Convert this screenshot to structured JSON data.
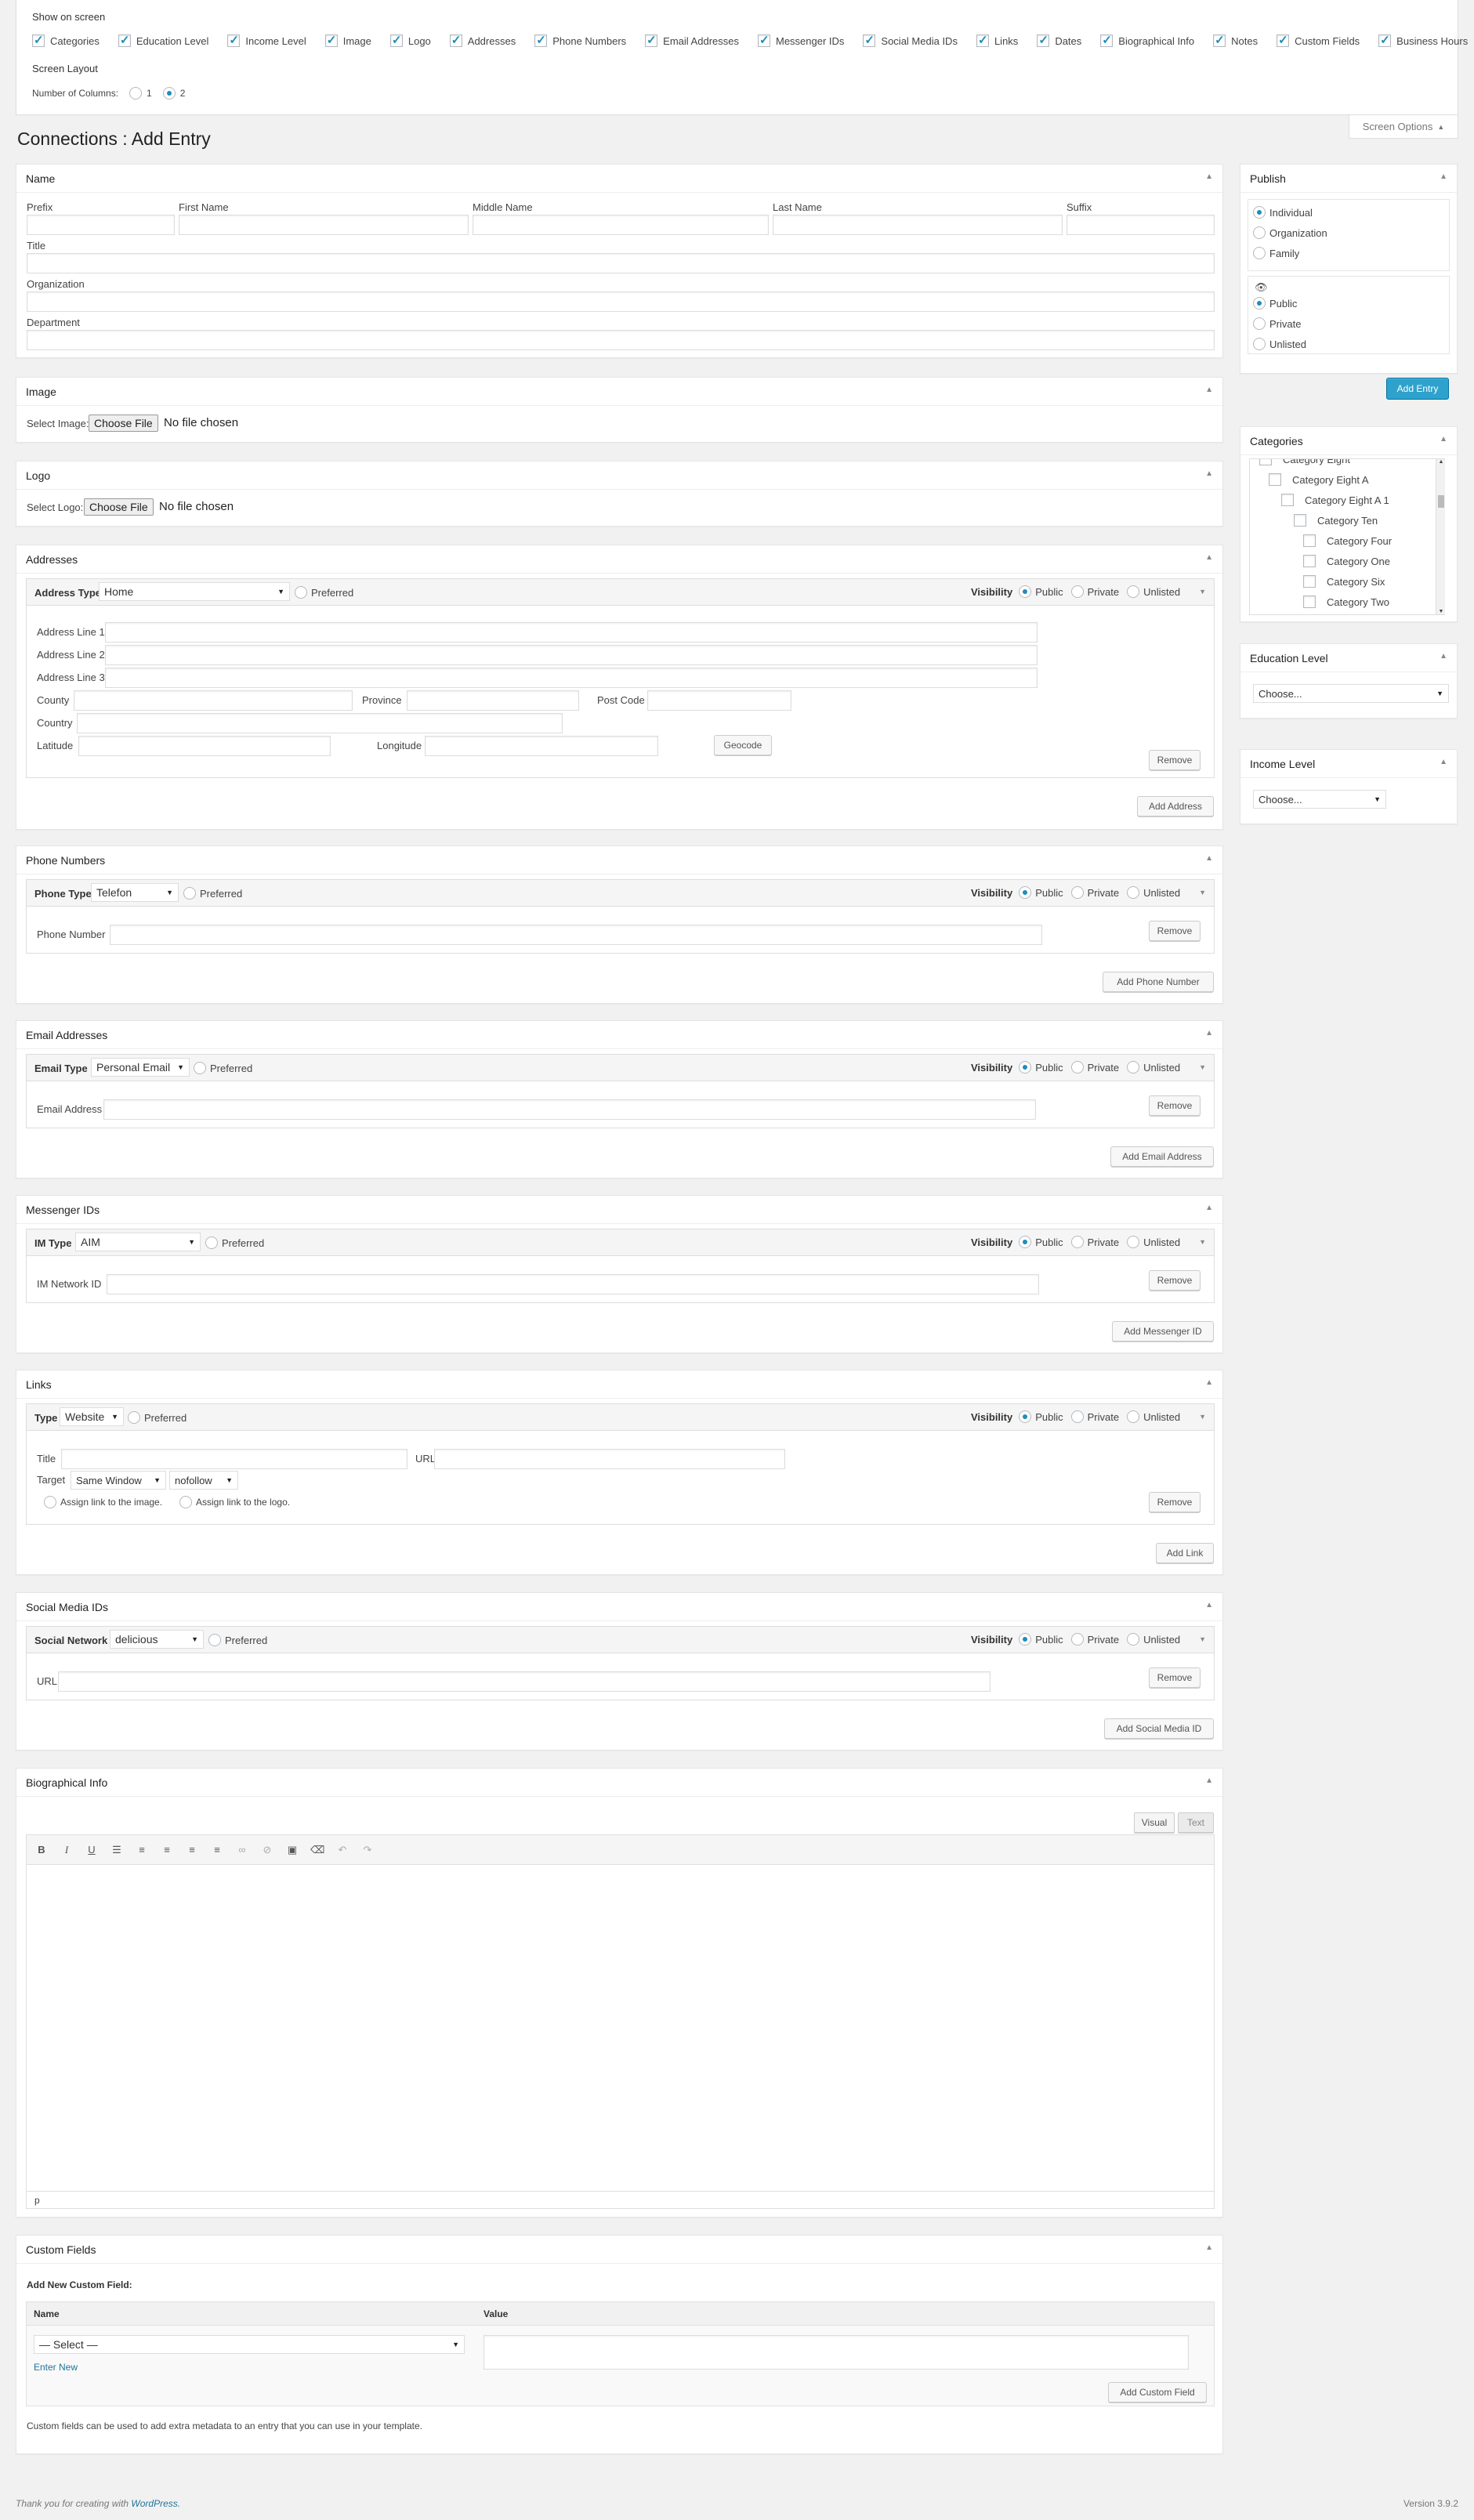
{
  "screen_options": {
    "title": "Show on screen",
    "items": [
      {
        "label": "Categories",
        "checked": true
      },
      {
        "label": "Education Level",
        "checked": true
      },
      {
        "label": "Income Level",
        "checked": true
      },
      {
        "label": "Image",
        "checked": true
      },
      {
        "label": "Logo",
        "checked": true
      },
      {
        "label": "Addresses",
        "checked": true
      },
      {
        "label": "Phone Numbers",
        "checked": true
      },
      {
        "label": "Email Addresses",
        "checked": true
      },
      {
        "label": "Messenger IDs",
        "checked": true
      },
      {
        "label": "Social Media IDs",
        "checked": true
      },
      {
        "label": "Links",
        "checked": true
      },
      {
        "label": "Dates",
        "checked": true
      },
      {
        "label": "Biographical Info",
        "checked": true
      },
      {
        "label": "Notes",
        "checked": true
      },
      {
        "label": "Custom Fields",
        "checked": true
      },
      {
        "label": "Business Hours",
        "checked": true
      }
    ],
    "layout_title": "Screen Layout",
    "columns_label": "Number of Columns:",
    "col1": "1",
    "col2": "2",
    "tab_label": "Screen Options"
  },
  "page_title": "Connections : Add Entry",
  "name_box": {
    "title": "Name",
    "prefix": "Prefix",
    "first": "First Name",
    "middle": "Middle Name",
    "last": "Last Name",
    "suffix": "Suffix",
    "title_label": "Title",
    "organization": "Organization",
    "department": "Department"
  },
  "image_box": {
    "title": "Image",
    "label": "Select Image:",
    "button": "Choose File",
    "status": "No file chosen"
  },
  "logo_box": {
    "title": "Logo",
    "label": "Select Logo:",
    "button": "Choose File",
    "status": "No file chosen"
  },
  "common": {
    "visibility": "Visibility",
    "public": "Public",
    "private": "Private",
    "unlisted": "Unlisted",
    "preferred": "Preferred",
    "remove": "Remove"
  },
  "addresses": {
    "title": "Addresses",
    "type_label": "Address Type",
    "type_value": "Home",
    "line1": "Address Line 1",
    "line2": "Address Line 2",
    "line3": "Address Line 3",
    "county": "County",
    "province": "Province",
    "postcode": "Post Code",
    "country": "Country",
    "latitude": "Latitude",
    "longitude": "Longitude",
    "geocode": "Geocode",
    "add": "Add Address"
  },
  "phones": {
    "title": "Phone Numbers",
    "type_label": "Phone Type",
    "type_value": "Telefon",
    "field": "Phone Number",
    "add": "Add Phone Number"
  },
  "emails": {
    "title": "Email Addresses",
    "type_label": "Email Type",
    "type_value": "Personal Email",
    "field": "Email Address",
    "add": "Add Email Address"
  },
  "messengers": {
    "title": "Messenger IDs",
    "type_label": "IM Type",
    "type_value": "AIM",
    "field": "IM Network ID",
    "add": "Add Messenger ID"
  },
  "links": {
    "title": "Links",
    "type_label": "Type",
    "type_value": "Website",
    "title_label": "Title",
    "url": "URL",
    "target": "Target",
    "target_value": "Same Window",
    "rel_value": "nofollow",
    "assign_image": "Assign link to the image.",
    "assign_logo": "Assign link to the logo.",
    "add": "Add Link"
  },
  "social": {
    "title": "Social Media IDs",
    "type_label": "Social Network",
    "type_value": "delicious",
    "url": "URL",
    "add": "Add Social Media ID"
  },
  "bio": {
    "title": "Biographical Info",
    "visual": "Visual",
    "text": "Text",
    "path": "p"
  },
  "custom": {
    "title": "Custom Fields",
    "add_new": "Add New Custom Field:",
    "name": "Name",
    "value": "Value",
    "select": "— Select —",
    "enter_new": "Enter New",
    "add": "Add Custom Field",
    "note": "Custom fields can be used to add extra metadata to an entry that you can use in your template."
  },
  "publish": {
    "title": "Publish",
    "types": [
      "Individual",
      "Organization",
      "Family"
    ],
    "vis": [
      "Public",
      "Private",
      "Unlisted"
    ],
    "add": "Add Entry"
  },
  "categories": {
    "title": "Categories",
    "items": [
      "Category Eight",
      "Category Eight A",
      "Category Eight A 1",
      "Category Ten",
      "Category Four",
      "Category One",
      "Category Six",
      "Category Two"
    ]
  },
  "education": {
    "title": "Education Level",
    "value": "Choose..."
  },
  "income": {
    "title": "Income Level",
    "value": "Choose..."
  },
  "footer": {
    "thanks": "Thank you for creating with",
    "wp": "WordPress.",
    "version": "Version 3.9.2"
  }
}
